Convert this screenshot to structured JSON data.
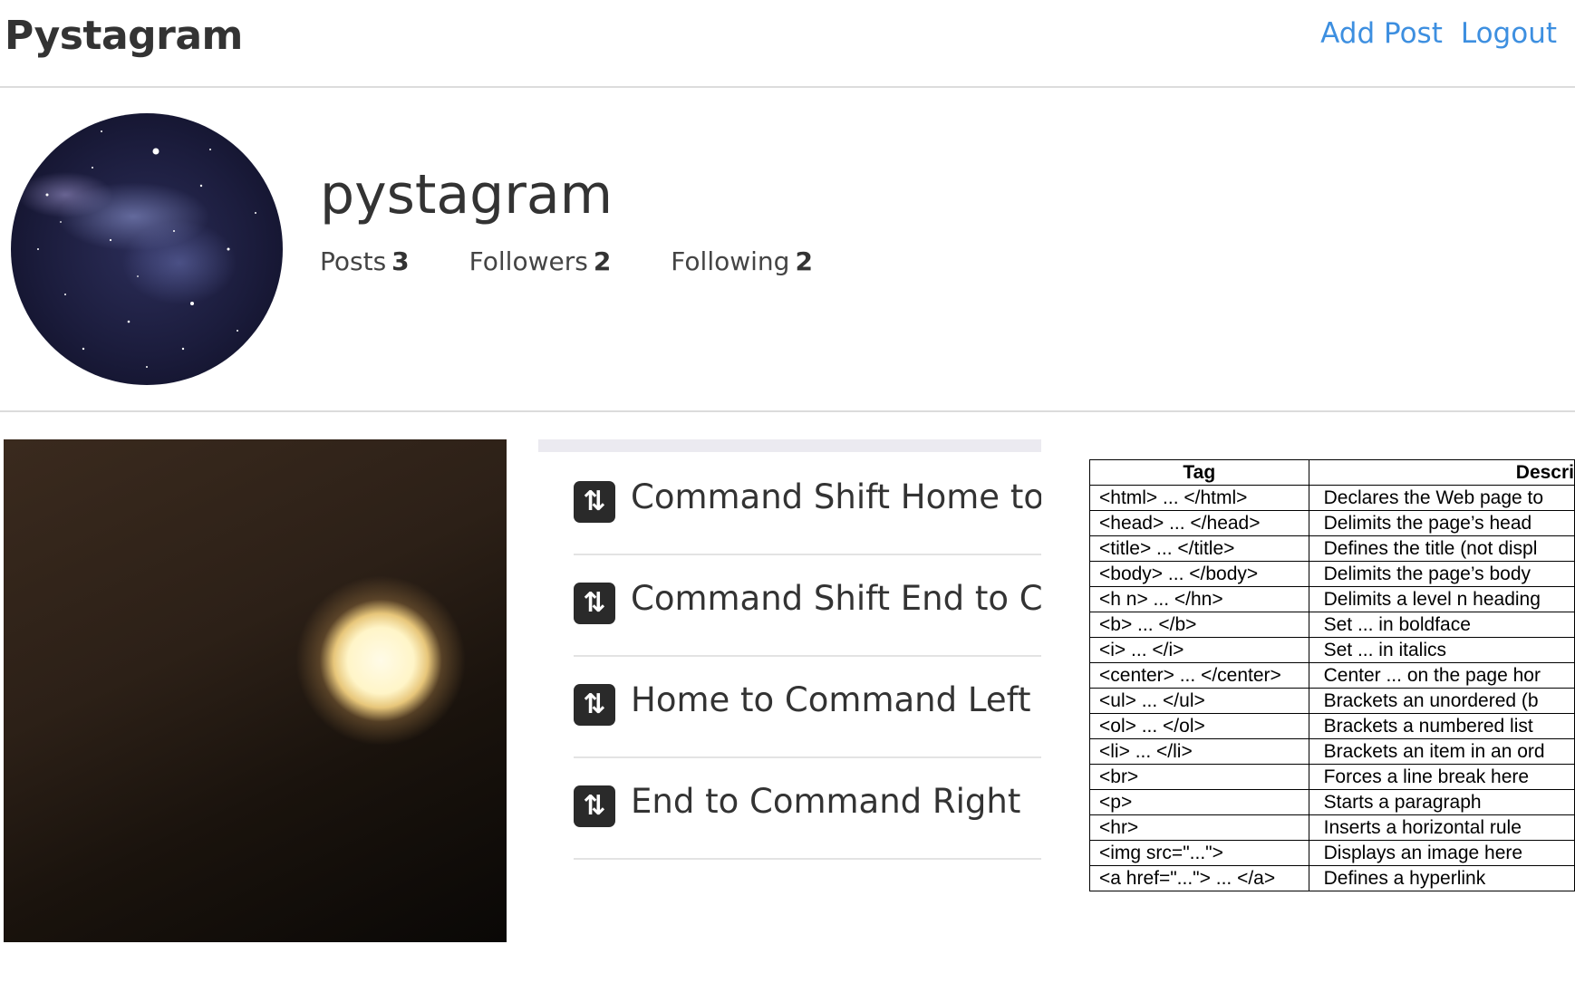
{
  "header": {
    "brand": "Pystagram",
    "nav": [
      "Add Post",
      "Logout"
    ]
  },
  "profile": {
    "username": "pystagram",
    "stats": [
      {
        "label": "Posts",
        "value": "3"
      },
      {
        "label": "Followers",
        "value": "2"
      },
      {
        "label": "Following",
        "value": "2"
      }
    ]
  },
  "posts": {
    "shortcuts": [
      "Command Shift Home to C",
      "Command Shift End to Cor",
      "Home to Command Left",
      "End to Command Right"
    ],
    "shortcut_icon": "⇅",
    "table": {
      "headers": [
        "Tag",
        "Descri"
      ],
      "rows": [
        [
          "<html> ... </html>",
          "Declares the Web page to"
        ],
        [
          "<head> ... </head>",
          "Delimits the page’s head"
        ],
        [
          "<title> ... </title>",
          "Defines the title (not displ"
        ],
        [
          "<body> ... </body>",
          "Delimits the page’s body"
        ],
        [
          "<h n> ... </hn>",
          "Delimits a level n heading"
        ],
        [
          "<b> ... </b>",
          "Set ... in boldface"
        ],
        [
          "<i> ... </i>",
          "Set ... in italics"
        ],
        [
          "<center>        ... </center>",
          "Center ... on the page hor"
        ],
        [
          "<ul> ... </ul>",
          "Brackets an unordered (b"
        ],
        [
          "<ol> ... </ol>",
          "Brackets a numbered list"
        ],
        [
          "<li> ... </li>",
          "Brackets an item in an ord"
        ],
        [
          "<br>",
          "Forces a line break here"
        ],
        [
          "<p>",
          "Starts a paragraph"
        ],
        [
          "<hr>",
          "Inserts a horizontal rule"
        ],
        [
          "<img src=\"...\">",
          "Displays an image here"
        ],
        [
          "<a href=\"...\"> ... </a>",
          "Defines a hyperlink"
        ]
      ]
    }
  }
}
